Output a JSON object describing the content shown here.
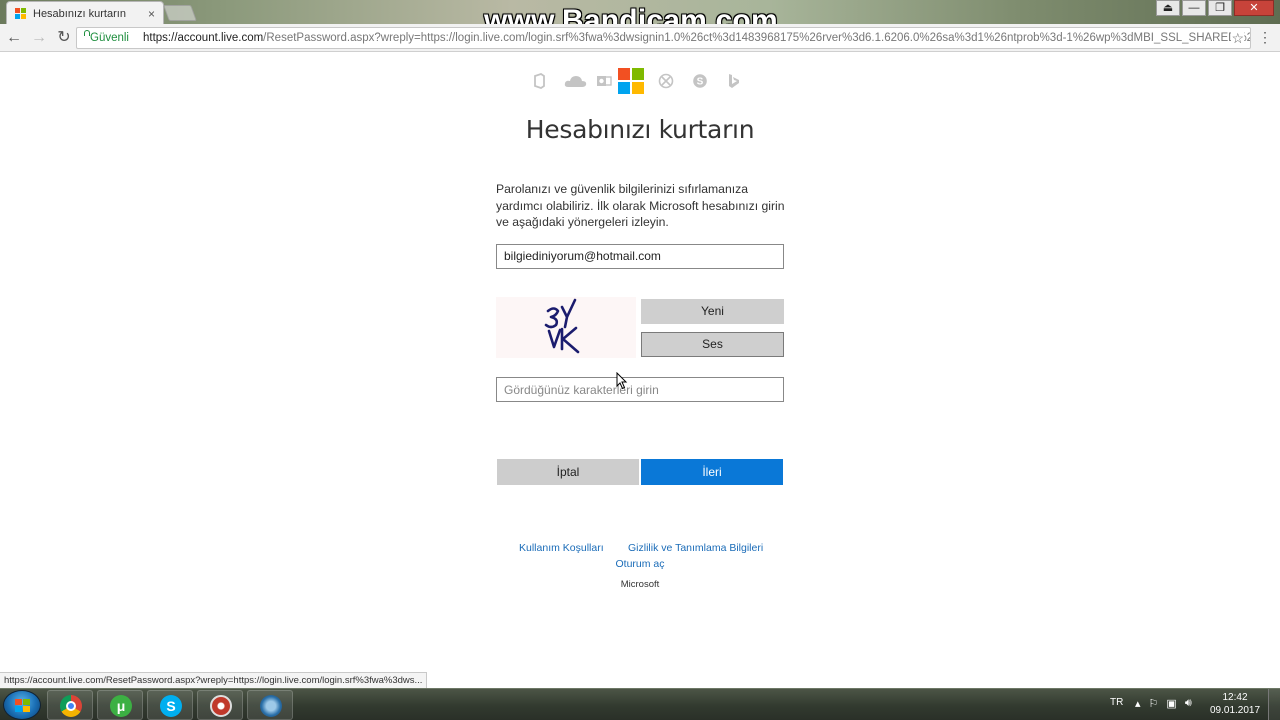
{
  "browser": {
    "tab_title": "Hesabınızı kurtarın",
    "tab_close": "×",
    "security_label": "Güvenli",
    "url_host": "https://account.live.com",
    "url_rest": "/ResetPassword.aspx?wreply=https://login.live.com/login.srf%3fwa%3dwsignin1.0%26ct%3d1483968175%26rver%3d6.1.6206.0%26sa%3d1%26ntprob%3d-1%26wp%3dMBI_SSL_SHARED%26wrep",
    "watermark": "www.Bandicam.com",
    "window_controls": {
      "help": "⏏",
      "minimize": "—",
      "restore": "❐",
      "close": "✕"
    }
  },
  "page": {
    "title": "Hesabınızı kurtarın",
    "intro": "Parolanızı ve güvenlik bilgilerinizi sıfırlamanıza yardımcı olabiliriz. İlk olarak Microsoft hesabınızı girin ve aşağıdaki yönergeleri izleyin.",
    "email_value": "bilgiediniyorum@hotmail.com",
    "captcha_text": "3Y\nVK",
    "new_captcha_label": "Yeni",
    "audio_captcha_label": "Ses",
    "captcha_placeholder": "Gördüğünüz karakterleri girin",
    "cancel_label": "İptal",
    "next_label": "İleri"
  },
  "footer": {
    "terms": "Kullanım Koşulları",
    "privacy": "Gizlilik ve Tanımlama Bilgileri",
    "signin": "Oturum aç",
    "brand": "Microsoft"
  },
  "status_bar": "https://account.live.com/ResetPassword.aspx?wreply=https://login.live.com/login.srf%3fwa%3dws...",
  "taskbar": {
    "apps": [
      "chrome-icon",
      "utorrent-icon",
      "skype-icon",
      "bandicam-icon",
      "app-icon"
    ],
    "language": "TR",
    "time": "12:42",
    "date": "09.01.2017"
  },
  "colors": {
    "ms_red": "#f25022",
    "ms_green": "#7fba00",
    "ms_blue": "#00a4ef",
    "ms_yellow": "#ffb900",
    "primary_button": "#0a78d7",
    "link": "#1b6cb8"
  }
}
